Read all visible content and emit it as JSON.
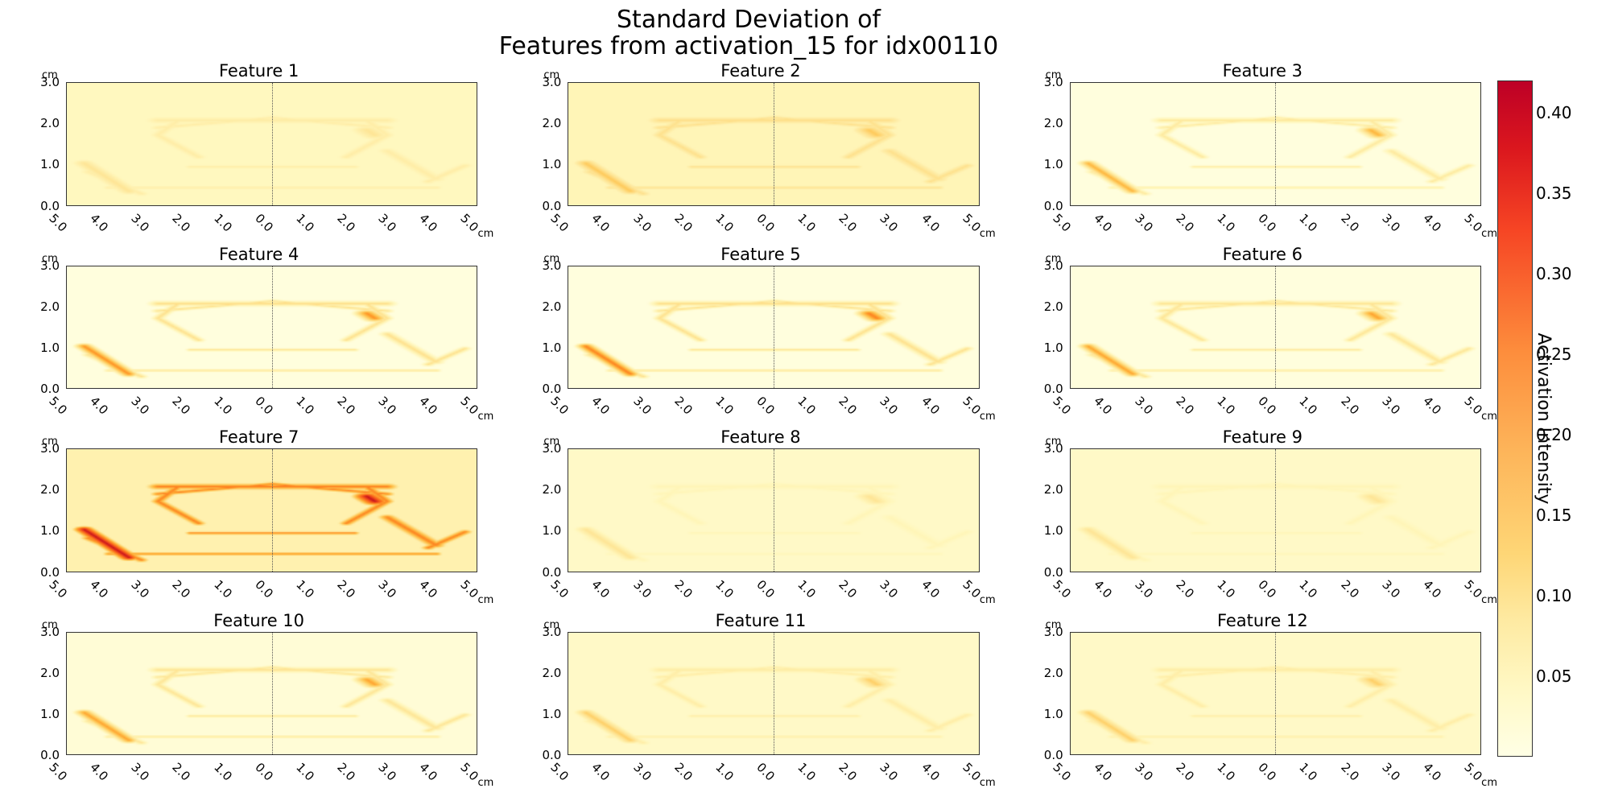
{
  "suptitle_line1": "Standard Deviation of",
  "suptitle_line2": "Features from activation_15 for idx00110",
  "axis_unit": "cm",
  "yticks": [
    "0.0",
    "1.0",
    "2.0",
    "3.0"
  ],
  "xticks": [
    "5.0",
    "4.0",
    "3.0",
    "2.0",
    "1.0",
    "0.0",
    "1.0",
    "2.0",
    "3.0",
    "4.0",
    "5.0"
  ],
  "colorbar": {
    "label": "Activation Intensity",
    "ticks": [
      {
        "v": 0.05,
        "label": "0.05"
      },
      {
        "v": 0.1,
        "label": "0.10"
      },
      {
        "v": 0.15,
        "label": "0.15"
      },
      {
        "v": 0.2,
        "label": "0.20"
      },
      {
        "v": 0.25,
        "label": "0.25"
      },
      {
        "v": 0.3,
        "label": "0.30"
      },
      {
        "v": 0.35,
        "label": "0.35"
      },
      {
        "v": 0.4,
        "label": "0.40"
      }
    ],
    "vmin": 0.0,
    "vmax": 0.42
  },
  "panels": [
    {
      "title": "Feature 1",
      "bg": 0.05,
      "edge": 0.08,
      "hot": 0.1
    },
    {
      "title": "Feature 2",
      "bg": 0.06,
      "edge": 0.11,
      "hot": 0.15
    },
    {
      "title": "Feature 3",
      "bg": 0.01,
      "edge": 0.09,
      "hot": 0.18
    },
    {
      "title": "Feature 4",
      "bg": 0.01,
      "edge": 0.11,
      "hot": 0.22
    },
    {
      "title": "Feature 5",
      "bg": 0.01,
      "edge": 0.11,
      "hot": 0.24
    },
    {
      "title": "Feature 6",
      "bg": 0.01,
      "edge": 0.1,
      "hot": 0.2
    },
    {
      "title": "Feature 7",
      "bg": 0.07,
      "edge": 0.24,
      "hot": 0.38
    },
    {
      "title": "Feature 8",
      "bg": 0.04,
      "edge": 0.06,
      "hot": 0.1
    },
    {
      "title": "Feature 9",
      "bg": 0.04,
      "edge": 0.06,
      "hot": 0.1
    },
    {
      "title": "Feature 10",
      "bg": 0.02,
      "edge": 0.1,
      "hot": 0.2
    },
    {
      "title": "Feature 11",
      "bg": 0.04,
      "edge": 0.08,
      "hot": 0.14
    },
    {
      "title": "Feature 12",
      "bg": 0.04,
      "edge": 0.08,
      "hot": 0.14
    }
  ],
  "chart_data": {
    "type": "heatmap",
    "layout": {
      "rows": 4,
      "cols": 3
    },
    "title": "Standard Deviation of Features from activation_15 for idx00110",
    "x_range_cm": [
      -5.0,
      5.0
    ],
    "y_range_cm": [
      0.0,
      3.0
    ],
    "x_ticks": [
      5.0,
      4.0,
      3.0,
      2.0,
      1.0,
      0.0,
      1.0,
      2.0,
      3.0,
      4.0,
      5.0
    ],
    "y_ticks": [
      0.0,
      1.0,
      2.0,
      3.0
    ],
    "xlabel": "cm",
    "ylabel": "cm",
    "center_line_x": 0.0,
    "colorbar_label": "Activation Intensity",
    "color_scale": [
      0.0,
      0.42
    ],
    "series": [
      {
        "name": "Feature 1",
        "background_intensity": 0.05,
        "mean_edge_intensity": 0.08,
        "peak_intensity": 0.1
      },
      {
        "name": "Feature 2",
        "background_intensity": 0.06,
        "mean_edge_intensity": 0.11,
        "peak_intensity": 0.15
      },
      {
        "name": "Feature 3",
        "background_intensity": 0.01,
        "mean_edge_intensity": 0.09,
        "peak_intensity": 0.18
      },
      {
        "name": "Feature 4",
        "background_intensity": 0.01,
        "mean_edge_intensity": 0.11,
        "peak_intensity": 0.22
      },
      {
        "name": "Feature 5",
        "background_intensity": 0.01,
        "mean_edge_intensity": 0.11,
        "peak_intensity": 0.24
      },
      {
        "name": "Feature 6",
        "background_intensity": 0.01,
        "mean_edge_intensity": 0.1,
        "peak_intensity": 0.2
      },
      {
        "name": "Feature 7",
        "background_intensity": 0.07,
        "mean_edge_intensity": 0.24,
        "peak_intensity": 0.38
      },
      {
        "name": "Feature 8",
        "background_intensity": 0.04,
        "mean_edge_intensity": 0.06,
        "peak_intensity": 0.1
      },
      {
        "name": "Feature 9",
        "background_intensity": 0.04,
        "mean_edge_intensity": 0.06,
        "peak_intensity": 0.1
      },
      {
        "name": "Feature 10",
        "background_intensity": 0.02,
        "mean_edge_intensity": 0.1,
        "peak_intensity": 0.2
      },
      {
        "name": "Feature 11",
        "background_intensity": 0.04,
        "mean_edge_intensity": 0.08,
        "peak_intensity": 0.14
      },
      {
        "name": "Feature 12",
        "background_intensity": 0.04,
        "mean_edge_intensity": 0.08,
        "peak_intensity": 0.14
      }
    ],
    "structure_note": "Each panel depicts the same curved bridge-like structure; intensities vary per feature. Values are read approximately from the shared colorbar."
  }
}
